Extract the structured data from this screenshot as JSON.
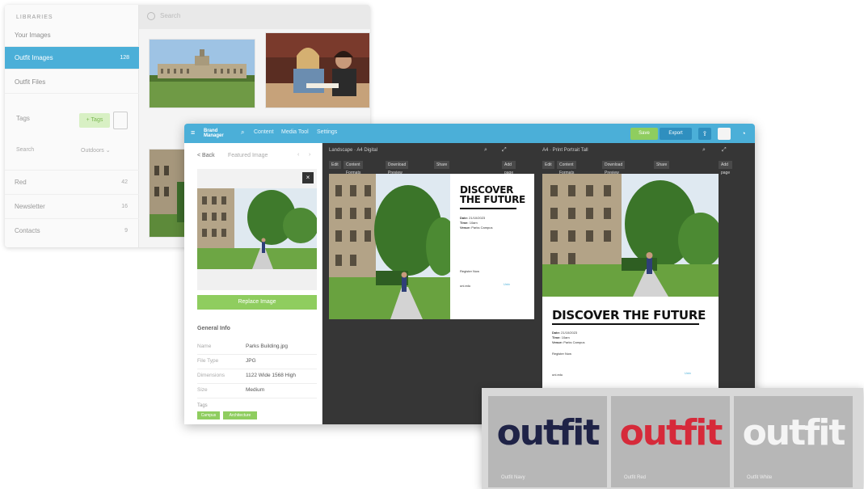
{
  "back_window": {
    "section_title": "LIBRARIES",
    "nav": [
      {
        "label": "Your Images",
        "count": ""
      },
      {
        "label": "Outfit Images",
        "count": "128"
      },
      {
        "label": "Outfit Files",
        "count": ""
      }
    ],
    "tags_label": "Tags",
    "tags_pill": "+ Tags",
    "search_label": "Search",
    "filter_label": "Outdoors",
    "rows": [
      {
        "label": "Red",
        "count": "42"
      },
      {
        "label": "Newsletter",
        "count": "16"
      },
      {
        "label": "Contacts",
        "count": "9"
      }
    ],
    "search_placeholder": "Search"
  },
  "main_window": {
    "logo_lines": [
      "Brand",
      "Manager"
    ],
    "nav": [
      "Content",
      "Media Tool",
      "Settings"
    ],
    "save_label": "Save",
    "export_label": "Export",
    "left_panel": {
      "back_label": "< Back",
      "title": "Featured Image",
      "replace_label": "Replace Image",
      "general_info_title": "General Info",
      "info": [
        {
          "k": "Name",
          "v": "Parks Building.jpg"
        },
        {
          "k": "File Type",
          "v": "JPG"
        },
        {
          "k": "Dimensions",
          "v": "1122 Wide 1568 High"
        },
        {
          "k": "Size",
          "v": "Medium"
        }
      ],
      "tags_label": "Tags",
      "tags": [
        "Campus",
        "Architecture"
      ]
    },
    "panes": [
      {
        "head": "Landscape · A4 Digital",
        "tools": [
          "Edit",
          "Content Formats",
          "Download Preview",
          "Share",
          "Add page"
        ],
        "headline": [
          "DISCOVER",
          "THE FUTURE"
        ],
        "meta": [
          {
            "k": "Date:",
            "v": "21/10/2023"
          },
          {
            "k": "Time:",
            "v": "10am"
          },
          {
            "k": "Venue:",
            "v": "Parks Campus"
          }
        ],
        "foot_text": "Register Now",
        "foot_small": "uni.edu",
        "foot_logo": "Univ"
      },
      {
        "head": "A4 · Print Portrait Tall",
        "tools": [
          "Edit",
          "Content Formats",
          "Download Preview",
          "Share",
          "Add page"
        ],
        "headline": [
          "DISCOVER THE FUTURE"
        ],
        "meta": [
          {
            "k": "Date:",
            "v": "21/10/2023"
          },
          {
            "k": "Time:",
            "v": "10am"
          },
          {
            "k": "Venue:",
            "v": "Parks Campus"
          }
        ],
        "foot_text": "Register Now",
        "foot_small": "uni.edu",
        "foot_logo": "Univ"
      }
    ]
  },
  "logos": [
    {
      "word": "outfit",
      "color": "#1f2347",
      "label": "Outfit Navy"
    },
    {
      "word": "outfit",
      "color": "#d62a3a",
      "label": "Outfit Red"
    },
    {
      "word": "outfit",
      "color": "#f4f4f4",
      "label": "Outfit White"
    }
  ]
}
